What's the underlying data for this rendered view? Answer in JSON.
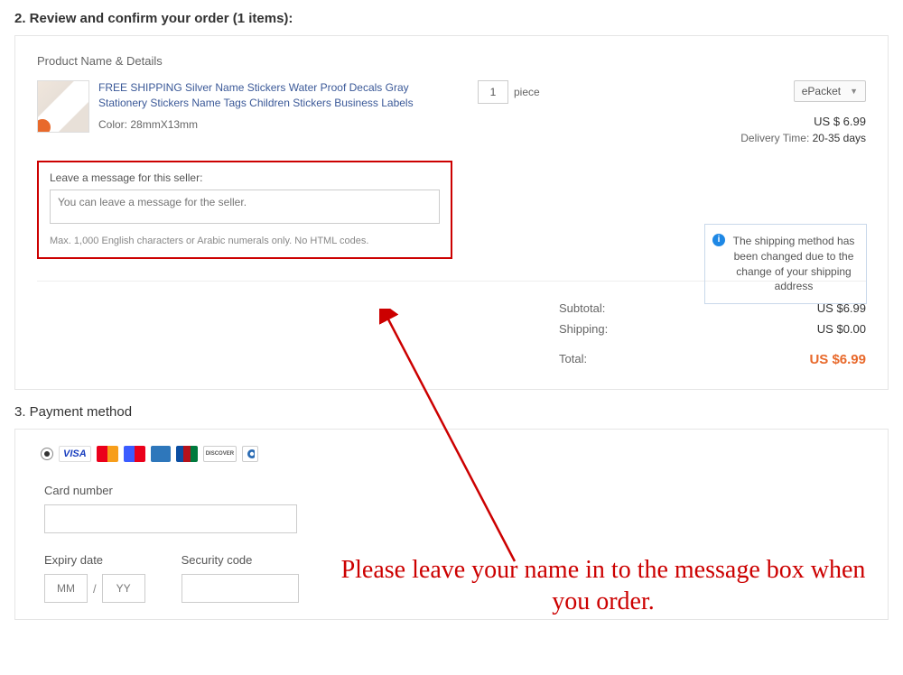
{
  "section_review_title": "2. Review and confirm your order (1 items):",
  "subhead": "Product Name & Details",
  "product": {
    "title": "FREE SHIPPING Silver Name Stickers Water Proof Decals Gray Stationery Stickers Name Tags Children Stickers Business Labels",
    "color_label": "Color:",
    "color_value": "28mmX13mm",
    "qty": "1",
    "qty_unit": "piece",
    "shipping_method": "ePacket",
    "price": "US  $ 6.99",
    "delivery_label": "Delivery Time:",
    "delivery_value": "20-35 days"
  },
  "message": {
    "label": "Leave a message for this seller:",
    "placeholder": "You can leave a message for the seller.",
    "hint": "Max. 1,000 English characters or Arabic numerals only. No HTML codes."
  },
  "notice": "The shipping method has been changed due to the change of your shipping address",
  "totals": {
    "subtotal_label": "Subtotal:",
    "subtotal_value": "US $6.99",
    "shipping_label": "Shipping:",
    "shipping_value": "US $0.00",
    "total_label": "Total:",
    "total_value": "US $6.99"
  },
  "section_payment_title": "3. Payment method",
  "payment": {
    "card_number_label": "Card number",
    "expiry_label": "Expiry date",
    "mm_placeholder": "MM",
    "yy_placeholder": "YY",
    "security_label": "Security code"
  },
  "annotation": "Please leave your name in to the message box when you order."
}
